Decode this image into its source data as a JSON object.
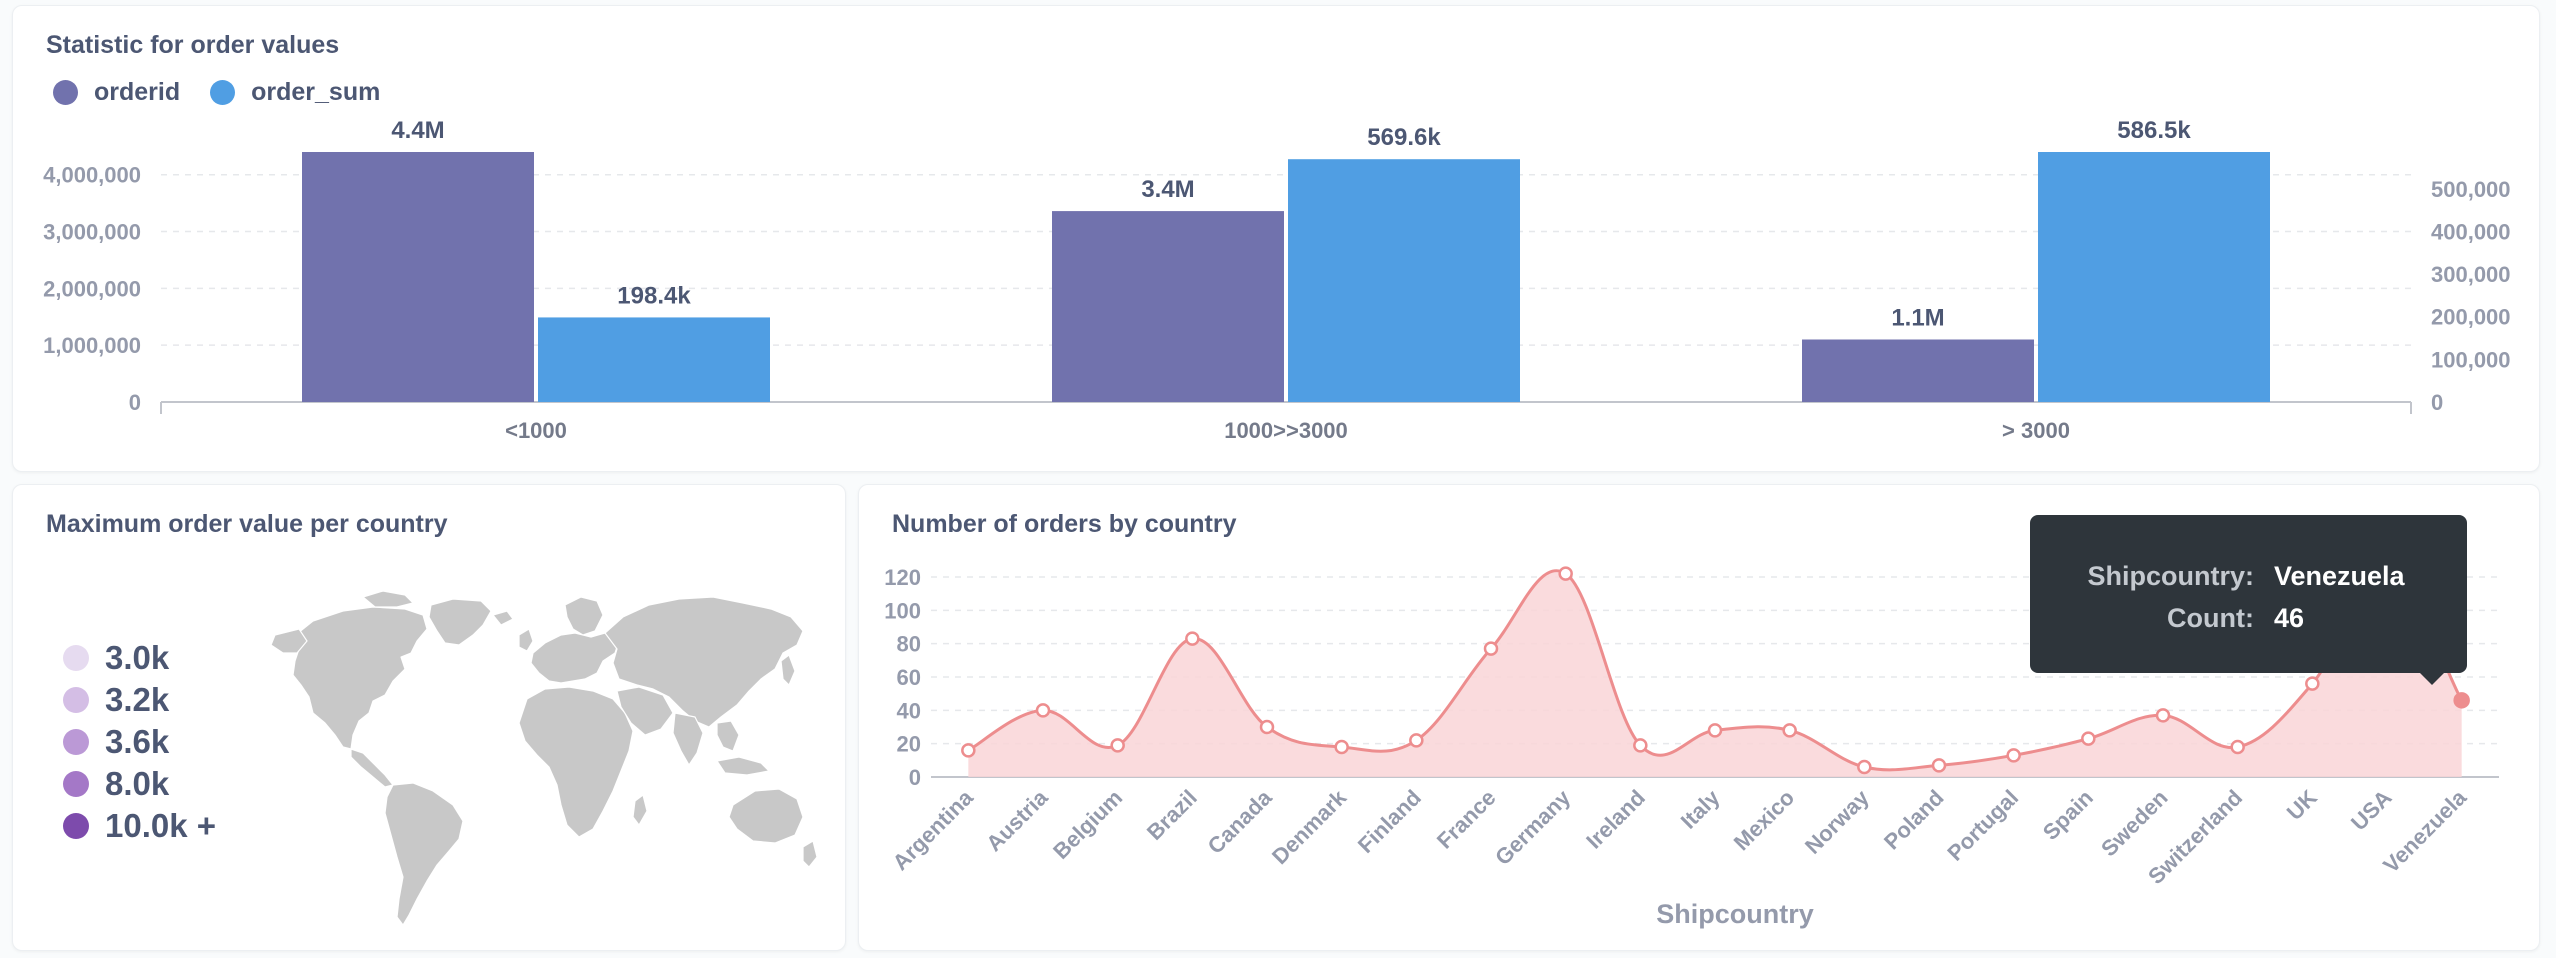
{
  "colors": {
    "orderid": "#7172ad",
    "order_sum": "#509ee3",
    "line": "#ed8d8e",
    "area": "#f9d5d7",
    "map_land": "#c8c8c8",
    "text": "#4c5773",
    "muted": "#949aab"
  },
  "top": {
    "title": "Statistic for order values",
    "legend": [
      "orderid",
      "order_sum"
    ]
  },
  "map": {
    "title": "Maximum order value per country",
    "legend": [
      {
        "label": "3.0k",
        "color": "#e6dbf0"
      },
      {
        "label": "3.2k",
        "color": "#d4bee5"
      },
      {
        "label": "3.6k",
        "color": "#bb99d6"
      },
      {
        "label": "8.0k",
        "color": "#a478c7"
      },
      {
        "label": "10.0k +",
        "color": "#7d4bac"
      }
    ]
  },
  "line": {
    "title": "Number of orders by country",
    "tooltip": {
      "key1": "Shipcountry:",
      "val1": "Venezuela",
      "key2": "Count:",
      "val2": "46"
    }
  },
  "chart_data": [
    {
      "type": "bar",
      "title": "Statistic for order values",
      "categories": [
        "<1000",
        "1000>>3000",
        "> 3000"
      ],
      "series": [
        {
          "name": "orderid",
          "axis": "left",
          "values": [
            4400000,
            3360000,
            1100000
          ],
          "labels": [
            "4.4M",
            "3.4M",
            "1.1M"
          ]
        },
        {
          "name": "order_sum",
          "axis": "right",
          "values": [
            198400,
            569600,
            586500
          ],
          "labels": [
            "198.4k",
            "569.6k",
            "586.5k"
          ]
        }
      ],
      "y_left": {
        "ticks": [
          0,
          1000000,
          2000000,
          3000000,
          4000000
        ],
        "tick_labels": [
          "0",
          "1,000,000",
          "2,000,000",
          "3,000,000",
          "4,000,000"
        ],
        "max": 4400000
      },
      "y_right": {
        "ticks": [
          0,
          100000,
          200000,
          300000,
          400000,
          500000
        ],
        "tick_labels": [
          "0",
          "100,000",
          "200,000",
          "300,000",
          "400,000",
          "500,000"
        ],
        "max": 586500
      },
      "grid": true,
      "legend": "top-left"
    },
    {
      "type": "area",
      "title": "Number of orders by country",
      "xlabel": "Shipcountry",
      "ylabel": "",
      "x": [
        "Argentina",
        "Austria",
        "Belgium",
        "Brazil",
        "Canada",
        "Denmark",
        "Finland",
        "France",
        "Germany",
        "Ireland",
        "Italy",
        "Mexico",
        "Norway",
        "Poland",
        "Portugal",
        "Spain",
        "Sweden",
        "Switzerland",
        "UK",
        "USA",
        "Venezuela"
      ],
      "series": [
        {
          "name": "Count",
          "values": [
            16,
            40,
            19,
            83,
            30,
            18,
            22,
            77,
            122,
            19,
            28,
            28,
            6,
            7,
            13,
            23,
            37,
            18,
            56,
            122,
            46
          ]
        }
      ],
      "ylim": [
        0,
        120
      ],
      "y_ticks": [
        0,
        20,
        40,
        60,
        80,
        100,
        120
      ],
      "grid": true
    }
  ]
}
